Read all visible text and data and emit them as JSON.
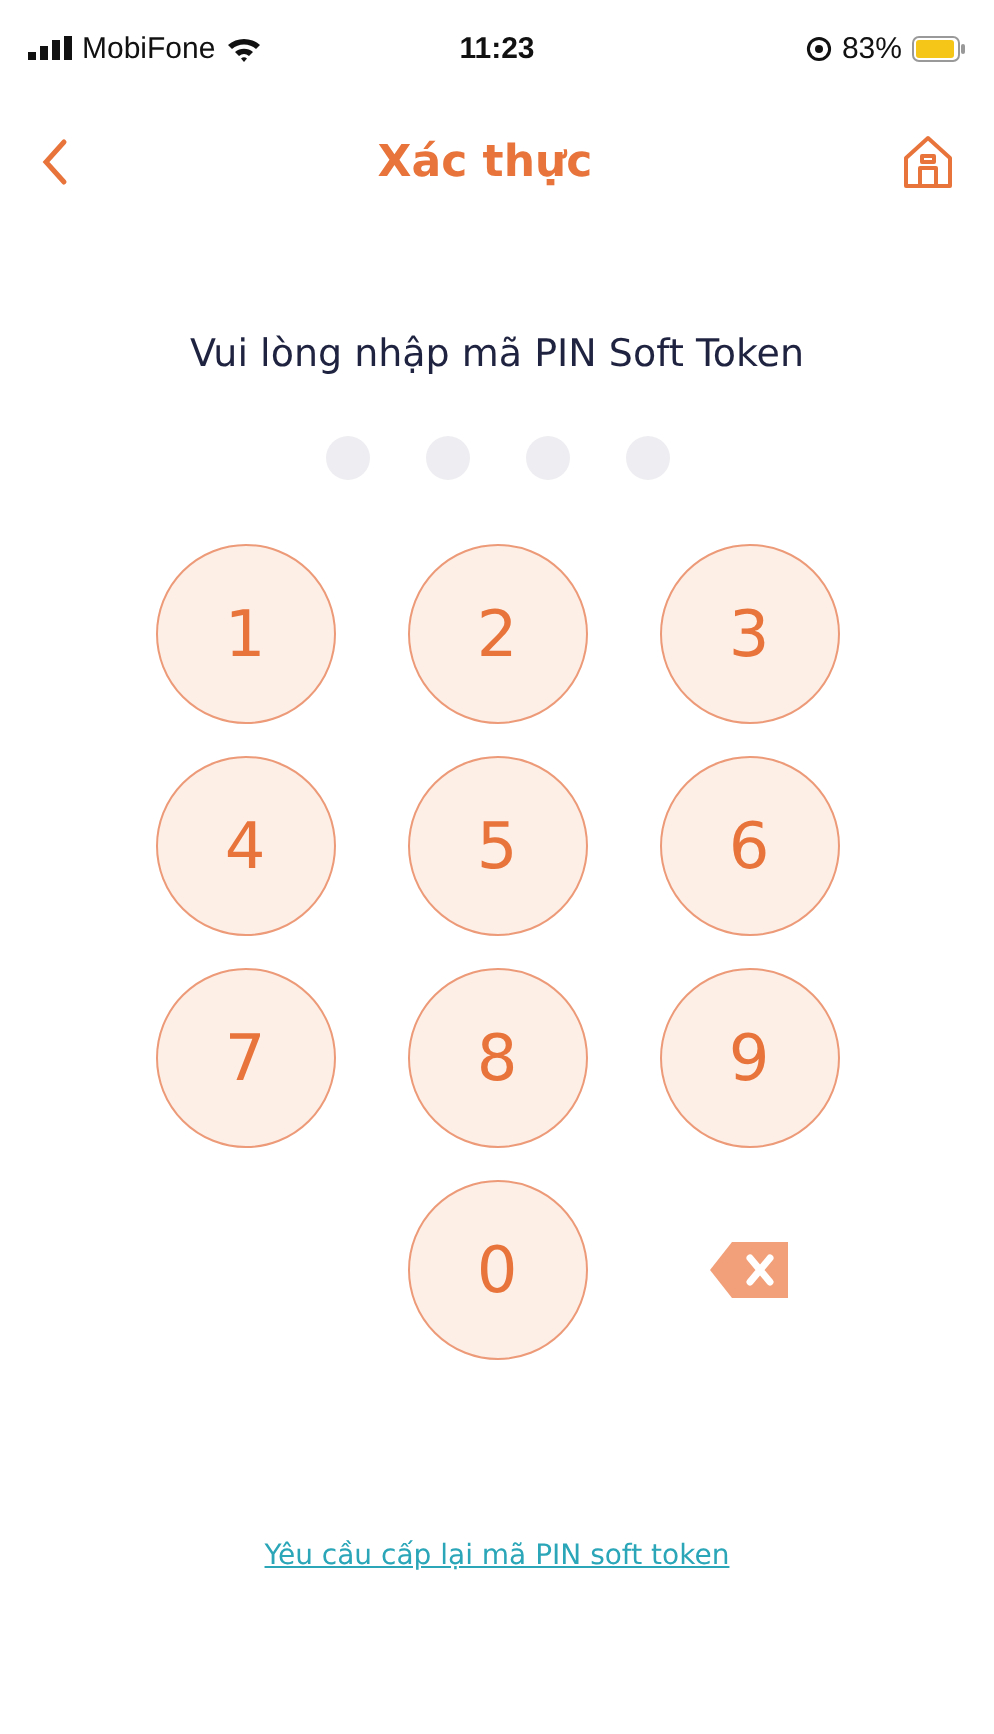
{
  "status_bar": {
    "carrier": "MobiFone",
    "time": "11:23",
    "battery": "83%"
  },
  "nav": {
    "title": "Xác thực"
  },
  "prompt": "Vui lòng nhập mã PIN Soft Token",
  "pin_dots": [
    {
      "filled": false
    },
    {
      "filled": false
    },
    {
      "filled": false
    },
    {
      "filled": false
    }
  ],
  "keypad": [
    {
      "kind": "digit",
      "label": "1"
    },
    {
      "kind": "digit",
      "label": "2"
    },
    {
      "kind": "digit",
      "label": "3"
    },
    {
      "kind": "digit",
      "label": "4"
    },
    {
      "kind": "digit",
      "label": "5"
    },
    {
      "kind": "digit",
      "label": "6"
    },
    {
      "kind": "digit",
      "label": "7"
    },
    {
      "kind": "digit",
      "label": "8"
    },
    {
      "kind": "digit",
      "label": "9"
    },
    {
      "kind": "blank"
    },
    {
      "kind": "digit",
      "label": "0"
    },
    {
      "kind": "delete"
    }
  ],
  "reset_link": "Yêu cầu cấp lại mã PIN soft token"
}
